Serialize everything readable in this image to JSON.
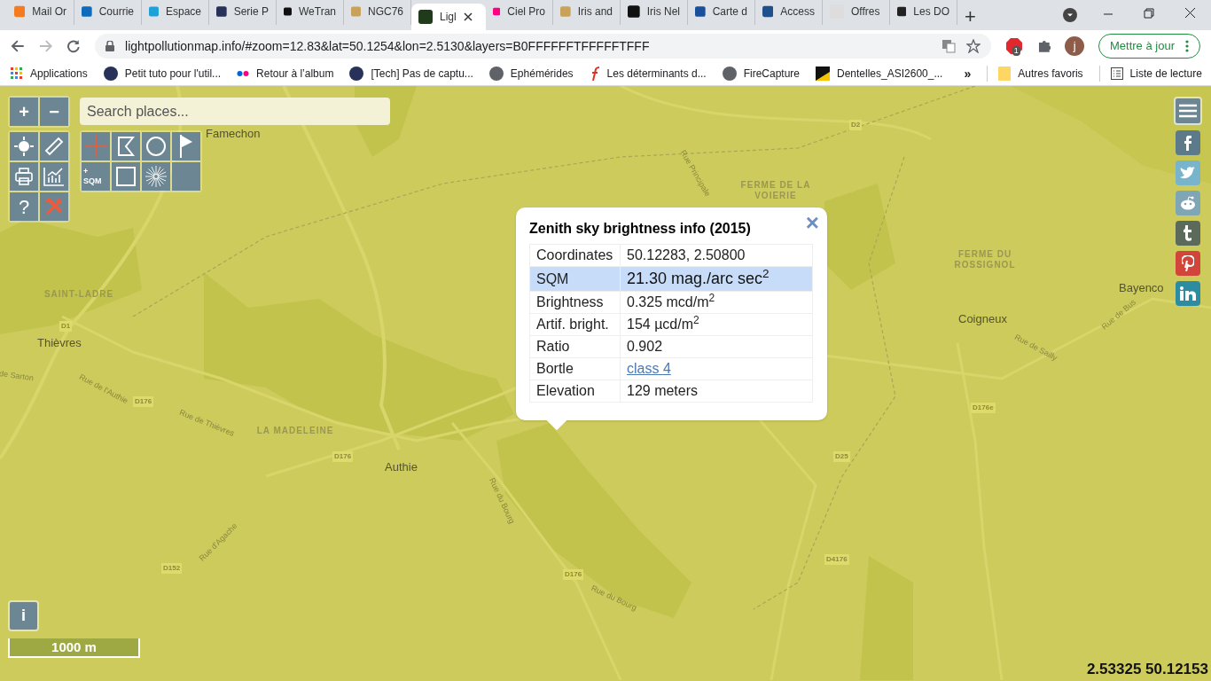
{
  "browser": {
    "tabs": [
      {
        "label": "Mail Or",
        "selected": false
      },
      {
        "label": "Courrie",
        "selected": false
      },
      {
        "label": "Espace",
        "selected": false
      },
      {
        "label": "Serie P",
        "selected": false
      },
      {
        "label": "WeTran",
        "selected": false
      },
      {
        "label": "NGC76",
        "selected": false
      },
      {
        "label": "Ligl",
        "selected": true
      },
      {
        "label": "Ciel Pro",
        "selected": false
      },
      {
        "label": "Iris and",
        "selected": false
      },
      {
        "label": "Iris Nel",
        "selected": false
      },
      {
        "label": "Carte d",
        "selected": false
      },
      {
        "label": "Access",
        "selected": false
      },
      {
        "label": "Offres",
        "selected": false
      },
      {
        "label": "Les DO",
        "selected": false
      }
    ],
    "new_tab": "+",
    "url": "lightpollutionmap.info/#zoom=12.83&lat=50.1254&lon=2.5130&layers=B0FFFFFFTFFFFFTFFF",
    "extension_badge": "1",
    "avatar": "j",
    "update_button": "Mettre à jour",
    "bookmarks": [
      "Applications",
      "Petit tuto pour l'util...",
      "Retour à l’album",
      "[Tech] Pas de captu...",
      "Ephémérides",
      "Les déterminants d...",
      "FireCapture",
      "Dentelles_ASI2600_..."
    ],
    "more_bookmarks": "»",
    "other_bookmarks": "Autres favoris",
    "reading_list": "Liste de lecture"
  },
  "map": {
    "zoom_in": "+",
    "zoom_out": "−",
    "help": "?",
    "sqm_tool": "+ SQM",
    "search": {
      "placeholder": "Search places..."
    },
    "labels": [
      {
        "text": "Famechon",
        "kind": "place"
      },
      {
        "text": "D2",
        "kind": "road"
      },
      {
        "text": "Rue Principale",
        "kind": "street"
      },
      {
        "text": "FERME DE LA VOIERIE",
        "kind": "locality"
      },
      {
        "text": "FERME DU ROSSIGNOL",
        "kind": "locality"
      },
      {
        "text": "Bayenco",
        "kind": "place"
      },
      {
        "text": "Coigneux",
        "kind": "place"
      },
      {
        "text": "Rue de Sailly",
        "kind": "street"
      },
      {
        "text": "Rue de Bus",
        "kind": "street"
      },
      {
        "text": "SAINT-LADRE",
        "kind": "locality"
      },
      {
        "text": "D1",
        "kind": "road"
      },
      {
        "text": "Thièvres",
        "kind": "place"
      },
      {
        "text": "de Sarton",
        "kind": "street"
      },
      {
        "text": "Rue de l'Authie",
        "kind": "street"
      },
      {
        "text": "D176",
        "kind": "road"
      },
      {
        "text": "Rue de Thièvres",
        "kind": "street"
      },
      {
        "text": "LA MADELEINE",
        "kind": "locality"
      },
      {
        "text": "D176",
        "kind": "road"
      },
      {
        "text": "Authie",
        "kind": "place"
      },
      {
        "text": "Rue du Bourg",
        "kind": "street"
      },
      {
        "text": "Rue d'Agache",
        "kind": "street"
      },
      {
        "text": "D152",
        "kind": "road"
      },
      {
        "text": "D176",
        "kind": "road"
      },
      {
        "text": "Rue du Bourg",
        "kind": "street"
      },
      {
        "text": "D176e",
        "kind": "road"
      },
      {
        "text": "D25",
        "kind": "road"
      },
      {
        "text": "D4176",
        "kind": "road"
      }
    ],
    "popup": {
      "title": "Zenith sky brightness info (2015)",
      "close": "×",
      "rows": [
        {
          "label": "Coordinates",
          "value": "50.12283, 2.50800",
          "selected": false,
          "kind": "text"
        },
        {
          "label": "SQM",
          "value": "21.30 mag./arc sec$^{2}$",
          "selected": true,
          "kind": "text"
        },
        {
          "label": "Brightness",
          "value": "0.325 mcd/m$^{2}$",
          "selected": false,
          "kind": "text"
        },
        {
          "label": "Artif. bright.",
          "value": "154 µcd/m$^{2}$",
          "selected": false,
          "kind": "text"
        },
        {
          "label": "Ratio",
          "value": "0.902",
          "selected": false,
          "kind": "text"
        },
        {
          "label": "Bortle",
          "value": "class 4",
          "selected": false,
          "kind": "link"
        },
        {
          "label": "Elevation",
          "value": "129 meters",
          "selected": false,
          "kind": "text"
        }
      ]
    },
    "info_button": "i",
    "scale": "1000 m",
    "cursor_coordinates": "2.53325 50.12153"
  }
}
